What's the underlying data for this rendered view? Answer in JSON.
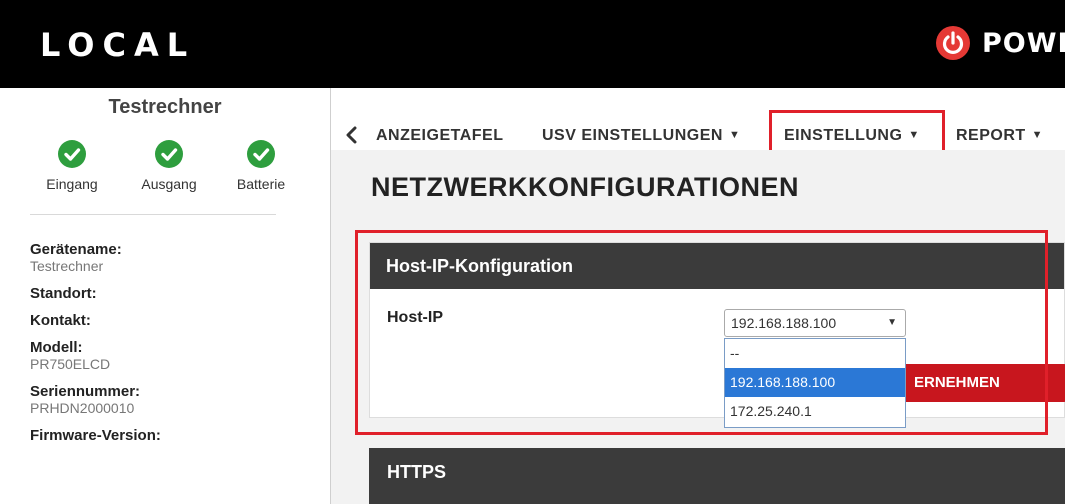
{
  "header": {
    "app_name": "LOCAL",
    "brand": "POWE"
  },
  "sidebar": {
    "device_title": "Testrechner",
    "status": [
      {
        "label": "Eingang",
        "icon": "check-circle-icon",
        "color": "#2e9e3e"
      },
      {
        "label": "Ausgang",
        "icon": "check-circle-icon",
        "color": "#2e9e3e"
      },
      {
        "label": "Batterie",
        "icon": "check-circle-icon",
        "color": "#2e9e3e"
      }
    ],
    "info": [
      {
        "key": "Gerätename:",
        "value": "Testrechner"
      },
      {
        "key": "Standort:",
        "value": ""
      },
      {
        "key": "Kontakt:",
        "value": ""
      },
      {
        "key": "Modell:",
        "value": "PR750ELCD"
      },
      {
        "key": "Seriennummer:",
        "value": "PRHDN2000010"
      },
      {
        "key": "Firmware-Version:",
        "value": ""
      }
    ]
  },
  "nav": {
    "back_icon": "chevron-left-icon",
    "items": [
      {
        "label": "ANZEIGETAFEL",
        "caret": ""
      },
      {
        "label": "USV EINSTELLUNGEN",
        "caret": "▼"
      },
      {
        "label": "EINSTELLUNG",
        "caret": "▼"
      },
      {
        "label": "REPORT",
        "caret": "▼"
      }
    ]
  },
  "main": {
    "title": "NETZWERKKONFIGURATIONEN",
    "host_panel": {
      "header": "Host-IP-Konfiguration",
      "field_label": "Host-IP",
      "selected_value": "192.168.188.100",
      "options": [
        "--",
        "192.168.188.100",
        "172.25.240.1"
      ],
      "apply_label": "ERNEHMEN"
    },
    "https_panel": {
      "header": "HTTPS"
    }
  },
  "colors": {
    "accent_red": "#c8161e",
    "highlight_red": "#e0202a",
    "ok_green": "#2e9e3e",
    "selected_blue": "#2b78d6"
  }
}
